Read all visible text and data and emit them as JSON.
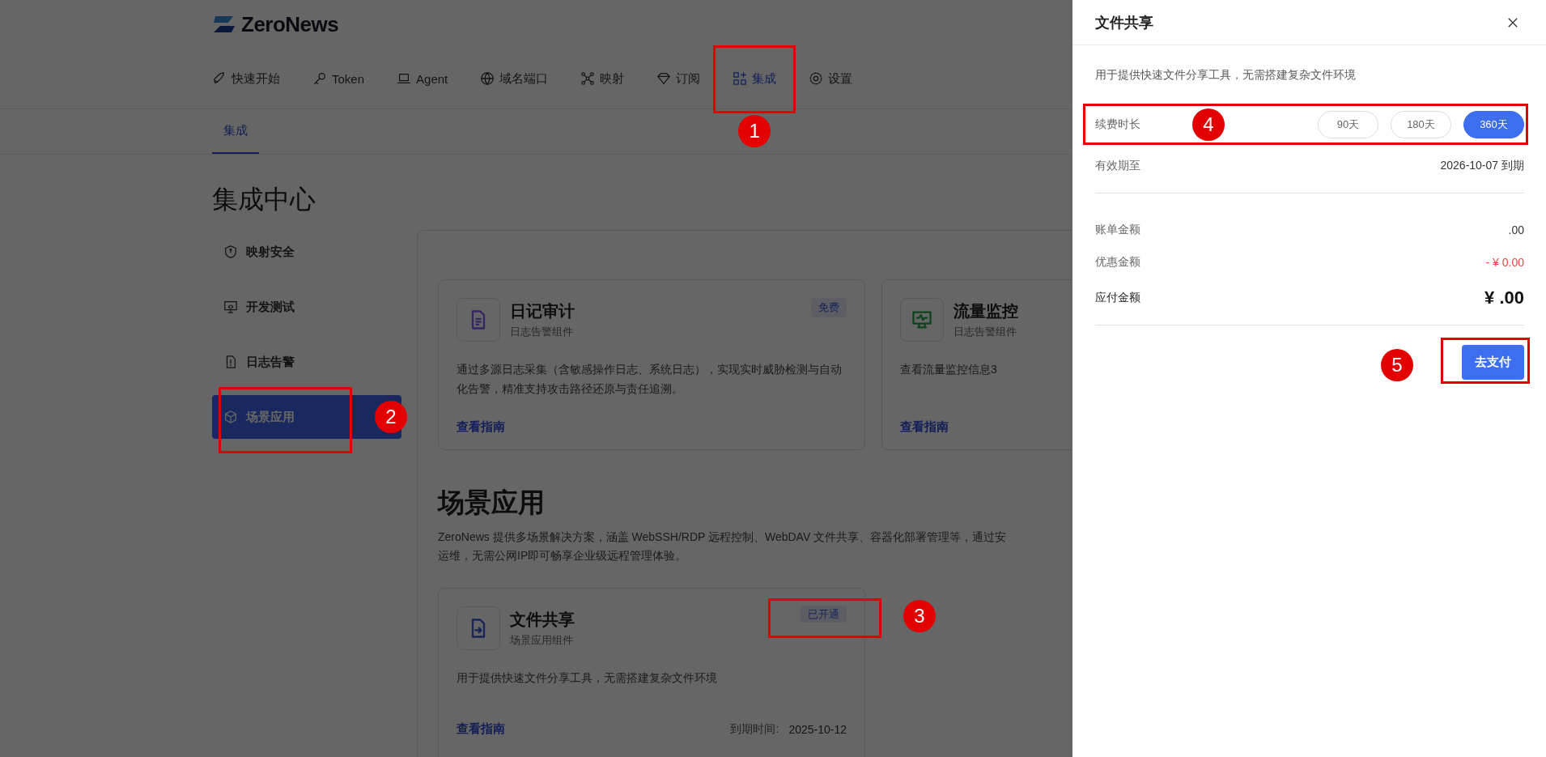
{
  "logo": {
    "text": "ZeroNews"
  },
  "nav": [
    {
      "label": "快速开始",
      "selected": false
    },
    {
      "label": "Token",
      "selected": false
    },
    {
      "label": "Agent",
      "selected": false
    },
    {
      "label": "域名端口",
      "selected": false
    },
    {
      "label": "映射",
      "selected": false
    },
    {
      "label": "订阅",
      "selected": false
    },
    {
      "label": "集成",
      "selected": true,
      "annotation": "1"
    },
    {
      "label": "设置",
      "selected": false
    }
  ],
  "subtabs": [
    {
      "label": "集成",
      "selected": true
    }
  ],
  "page_title": "集成中心",
  "sidebar": [
    {
      "label": "映射安全",
      "selected": false
    },
    {
      "label": "开发测试",
      "selected": false
    },
    {
      "label": "日志告警",
      "selected": false
    },
    {
      "label": "场景应用",
      "selected": true,
      "annotation": "2"
    }
  ],
  "cards": [
    {
      "title": "日记审计",
      "subtitle": "日志告警组件",
      "color": "#382562",
      "badge": "免费",
      "description": "通过多源日志采集（含敏感操作日志、系统日志），实现实时威胁检测与自动化告警，精准支持攻击路径还原与责任追溯。",
      "link": "查看指南"
    },
    {
      "title": "流量监控",
      "subtitle": "日志告警组件",
      "color": "#0e431e",
      "description": "查看流量监控信息3",
      "link": "查看指南"
    }
  ],
  "section": {
    "title": "场景应用",
    "description": "ZeroNews 提供多场景解决方案，涵盖 WebSSH/RDP 远程控制、WebDAV 文件共享、容器化部署管理等，通过安",
    "description_2": "运维，无需公网IP即可畅享企业级远程管理体验。"
  },
  "scenario_cards": [
    {
      "title": "文件共享",
      "subtitle": "场景应用组件",
      "color": "#182458",
      "badge": "已开通",
      "badge_annotation": "3",
      "description": "用于提供快速文件分享工具，无需搭建复杂文件环境",
      "link": "查看指南",
      "expiry_label": "到期时间:",
      "expiry_value": "2025-10-12"
    }
  ],
  "drawer": {
    "title": "文件共享",
    "description": "用于提供快速文件分享工具，无需搭建复杂文件环境",
    "duration": {
      "label": "续费时长",
      "annotation": "4",
      "options": [
        {
          "label": "90天",
          "selected": false
        },
        {
          "label": "180天",
          "selected": false
        },
        {
          "label": "360天",
          "selected": true
        }
      ]
    },
    "valid_until": {
      "label": "有效期至",
      "value": "2026-10-07 到期"
    },
    "amounts": [
      {
        "label": "账单金额",
        "value": ".00",
        "kind": "normal"
      },
      {
        "label": "优惠金额",
        "value": "- ¥ 0.00",
        "kind": "discount"
      },
      {
        "label": "应付金额",
        "value": "¥ .00",
        "kind": "total"
      }
    ],
    "pay_button": {
      "label": "去支付",
      "annotation": "5"
    }
  }
}
